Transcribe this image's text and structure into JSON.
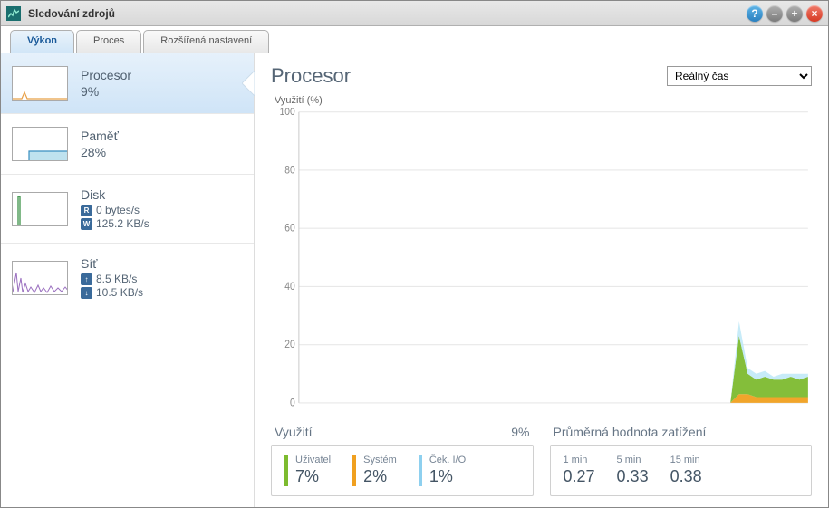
{
  "window": {
    "title": "Sledování zdrojů"
  },
  "tabs": [
    {
      "label": "Výkon",
      "active": true
    },
    {
      "label": "Proces",
      "active": false
    },
    {
      "label": "Rozšířená nastavení",
      "active": false
    }
  ],
  "sidebar": {
    "cpu": {
      "title": "Procesor",
      "value": "9%"
    },
    "memory": {
      "title": "Paměť",
      "value": "28%"
    },
    "disk": {
      "title": "Disk",
      "read": "0 bytes/s",
      "write": "125.2 KB/s"
    },
    "network": {
      "title": "Síť",
      "up": "8.5 KB/s",
      "down": "10.5 KB/s"
    }
  },
  "main": {
    "title": "Procesor",
    "time_select": "Reálný čas",
    "chart_ylabel": "Využití (%)"
  },
  "chart_data": {
    "type": "area",
    "ylabel": "Využití (%)",
    "ylim": [
      0,
      100
    ],
    "yticks": [
      0,
      20,
      40,
      60,
      80,
      100
    ],
    "x": [
      0,
      1,
      2,
      3,
      4,
      5,
      6,
      7,
      8,
      9,
      10,
      11,
      12,
      13,
      14,
      15,
      16,
      17,
      18,
      19,
      20,
      21,
      22,
      23,
      24,
      25,
      26,
      27,
      28,
      29,
      30,
      31,
      32,
      33,
      34,
      35,
      36,
      37,
      38,
      39,
      40,
      41,
      42,
      43,
      44,
      45,
      46,
      47,
      48,
      49,
      50,
      51,
      52,
      53,
      54,
      55,
      56,
      57,
      58,
      59
    ],
    "series": [
      {
        "name": "Uživatel",
        "color": "#7dbb2f",
        "values": [
          0,
          0,
          0,
          0,
          0,
          0,
          0,
          0,
          0,
          0,
          0,
          0,
          0,
          0,
          0,
          0,
          0,
          0,
          0,
          0,
          0,
          0,
          0,
          0,
          0,
          0,
          0,
          0,
          0,
          0,
          0,
          0,
          0,
          0,
          0,
          0,
          0,
          0,
          0,
          0,
          0,
          0,
          0,
          0,
          0,
          0,
          0,
          0,
          0,
          0,
          0,
          20,
          7,
          6,
          7,
          6,
          6,
          7,
          6,
          7
        ]
      },
      {
        "name": "Systém",
        "color": "#f0a020",
        "values": [
          0,
          0,
          0,
          0,
          0,
          0,
          0,
          0,
          0,
          0,
          0,
          0,
          0,
          0,
          0,
          0,
          0,
          0,
          0,
          0,
          0,
          0,
          0,
          0,
          0,
          0,
          0,
          0,
          0,
          0,
          0,
          0,
          0,
          0,
          0,
          0,
          0,
          0,
          0,
          0,
          0,
          0,
          0,
          0,
          0,
          0,
          0,
          0,
          0,
          0,
          0,
          3,
          3,
          2,
          2,
          2,
          2,
          2,
          2,
          2
        ]
      },
      {
        "name": "Ček. I/O",
        "color": "#bde7f7",
        "values": [
          0,
          0,
          0,
          0,
          0,
          0,
          0,
          0,
          0,
          0,
          0,
          0,
          0,
          0,
          0,
          0,
          0,
          0,
          0,
          0,
          0,
          0,
          0,
          0,
          0,
          0,
          0,
          0,
          0,
          0,
          0,
          0,
          0,
          0,
          0,
          0,
          0,
          0,
          0,
          0,
          0,
          0,
          0,
          0,
          0,
          0,
          0,
          0,
          0,
          0,
          0,
          5,
          2,
          2,
          2,
          1,
          2,
          1,
          2,
          1
        ]
      }
    ]
  },
  "utilization": {
    "header_label": "Využití",
    "header_value": "9%",
    "user": {
      "label": "Uživatel",
      "value": "7%"
    },
    "system": {
      "label": "Systém",
      "value": "2%"
    },
    "iowait": {
      "label": "Ček. I/O",
      "value": "1%"
    }
  },
  "load": {
    "header_label": "Průměrná hodnota zatížení",
    "cols": [
      {
        "label": "1 min",
        "value": "0.27"
      },
      {
        "label": "5 min",
        "value": "0.33"
      },
      {
        "label": "15 min",
        "value": "0.38"
      }
    ]
  }
}
